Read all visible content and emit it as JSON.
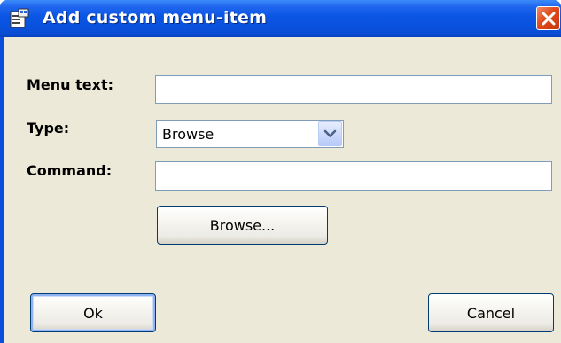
{
  "window": {
    "title": "Add custom menu-item",
    "title_icon": "properties-icon",
    "close_icon": "close-icon"
  },
  "form": {
    "menu_text": {
      "label": "Menu text:",
      "value": ""
    },
    "type": {
      "label": "Type:",
      "value": "Browse"
    },
    "command": {
      "label": "Command:",
      "value": ""
    },
    "browse_button": "Browse..."
  },
  "buttons": {
    "ok": "Ok",
    "cancel": "Cancel"
  },
  "colors": {
    "titlebar": "#0a55e4",
    "client": "#ece9d8",
    "close": "#e04a1c",
    "field_border": "#7f9db9"
  }
}
